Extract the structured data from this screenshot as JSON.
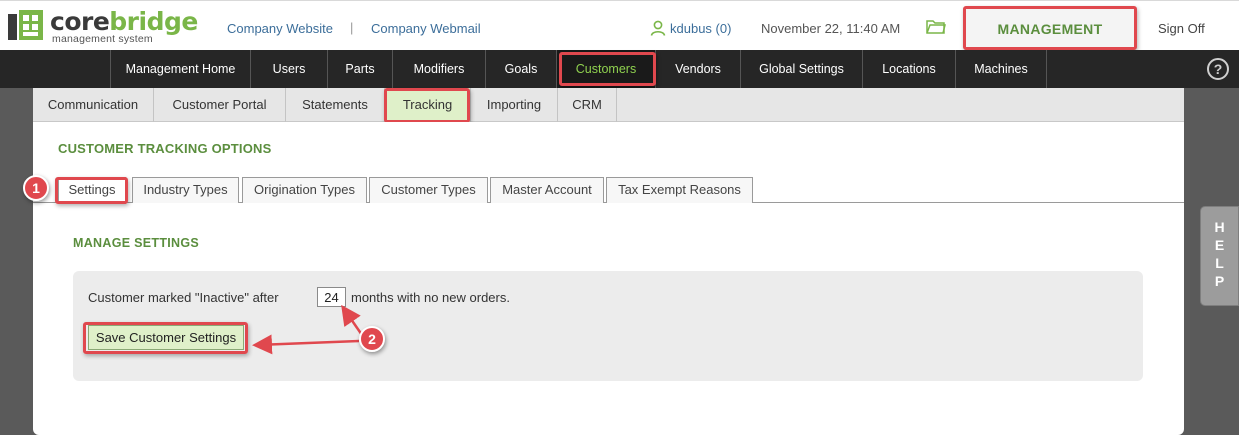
{
  "brand": {
    "logo_main_a": "core",
    "logo_main_b": "bridge",
    "logo_sub": "management system",
    "accent_green": "#7ab648",
    "heading_green": "#5b8e3e",
    "annotation_red": "#e0484e"
  },
  "header": {
    "company_website": "Company Website",
    "separator": "|",
    "company_webmail": "Company Webmail",
    "user": "kdubus (0)",
    "datetime": "November 22, 11:40 AM",
    "management_label": "MANAGEMENT",
    "sign_off": "Sign Off"
  },
  "main_nav": {
    "items": [
      {
        "label": "Management Home"
      },
      {
        "label": "Users"
      },
      {
        "label": "Parts"
      },
      {
        "label": "Modifiers"
      },
      {
        "label": "Goals"
      },
      {
        "label": "Customers"
      },
      {
        "label": "Vendors"
      },
      {
        "label": "Global Settings"
      },
      {
        "label": "Locations"
      },
      {
        "label": "Machines"
      }
    ],
    "active": "Customers",
    "help_glyph": "?"
  },
  "sub_nav": {
    "items": [
      {
        "label": "Communication"
      },
      {
        "label": "Customer Portal"
      },
      {
        "label": "Statements"
      },
      {
        "label": "Tracking"
      },
      {
        "label": "Importing"
      },
      {
        "label": "CRM"
      }
    ],
    "active": "Tracking"
  },
  "page": {
    "title": "CUSTOMER TRACKING OPTIONS",
    "tabs": [
      {
        "label": "Settings"
      },
      {
        "label": "Industry Types"
      },
      {
        "label": "Origination Types"
      },
      {
        "label": "Customer Types"
      },
      {
        "label": "Master Account"
      },
      {
        "label": "Tax Exempt Reasons"
      }
    ],
    "active_tab": "Settings",
    "section_title": "MANAGE SETTINGS",
    "inactive_prefix": "Customer marked \"Inactive\" after",
    "inactive_months": "24",
    "inactive_suffix": "months with no new orders.",
    "save_button": "Save Customer Settings"
  },
  "side_help": {
    "letters": [
      "H",
      "E",
      "L",
      "P"
    ]
  },
  "callouts": {
    "one": "1",
    "two": "2"
  }
}
